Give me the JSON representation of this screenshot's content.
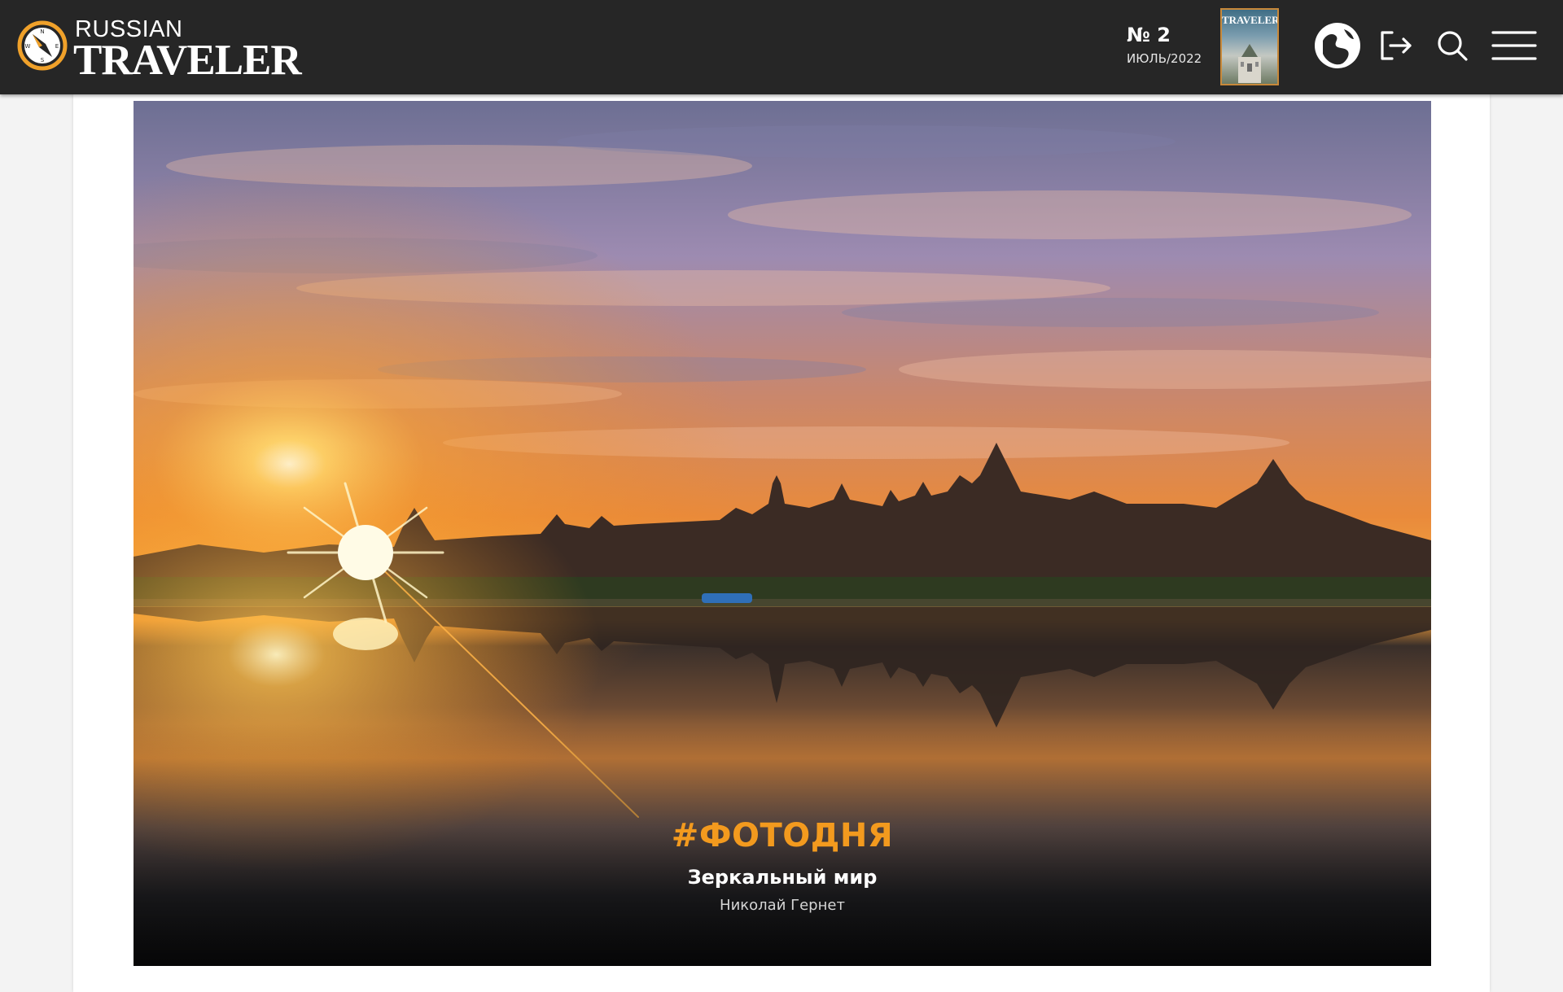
{
  "header": {
    "logo": {
      "top": "RUSSIAN",
      "main": "TRAVELER"
    },
    "issue": {
      "number": "№ 2",
      "date": "ИЮЛЬ/2022"
    },
    "cover": {
      "title": "TRAVELER"
    },
    "icons": {
      "club": "club-globe-icon",
      "login": "login-icon",
      "search": "search-icon",
      "menu": "hamburger-menu-icon"
    }
  },
  "hero": {
    "tag": "#ФОТОДНЯ",
    "title": "Зеркальный мир",
    "author": "Николай Гернет"
  },
  "colors": {
    "header_bg": "#262626",
    "accent": "#f39a1e",
    "page_bg": "#f3f3f3"
  }
}
